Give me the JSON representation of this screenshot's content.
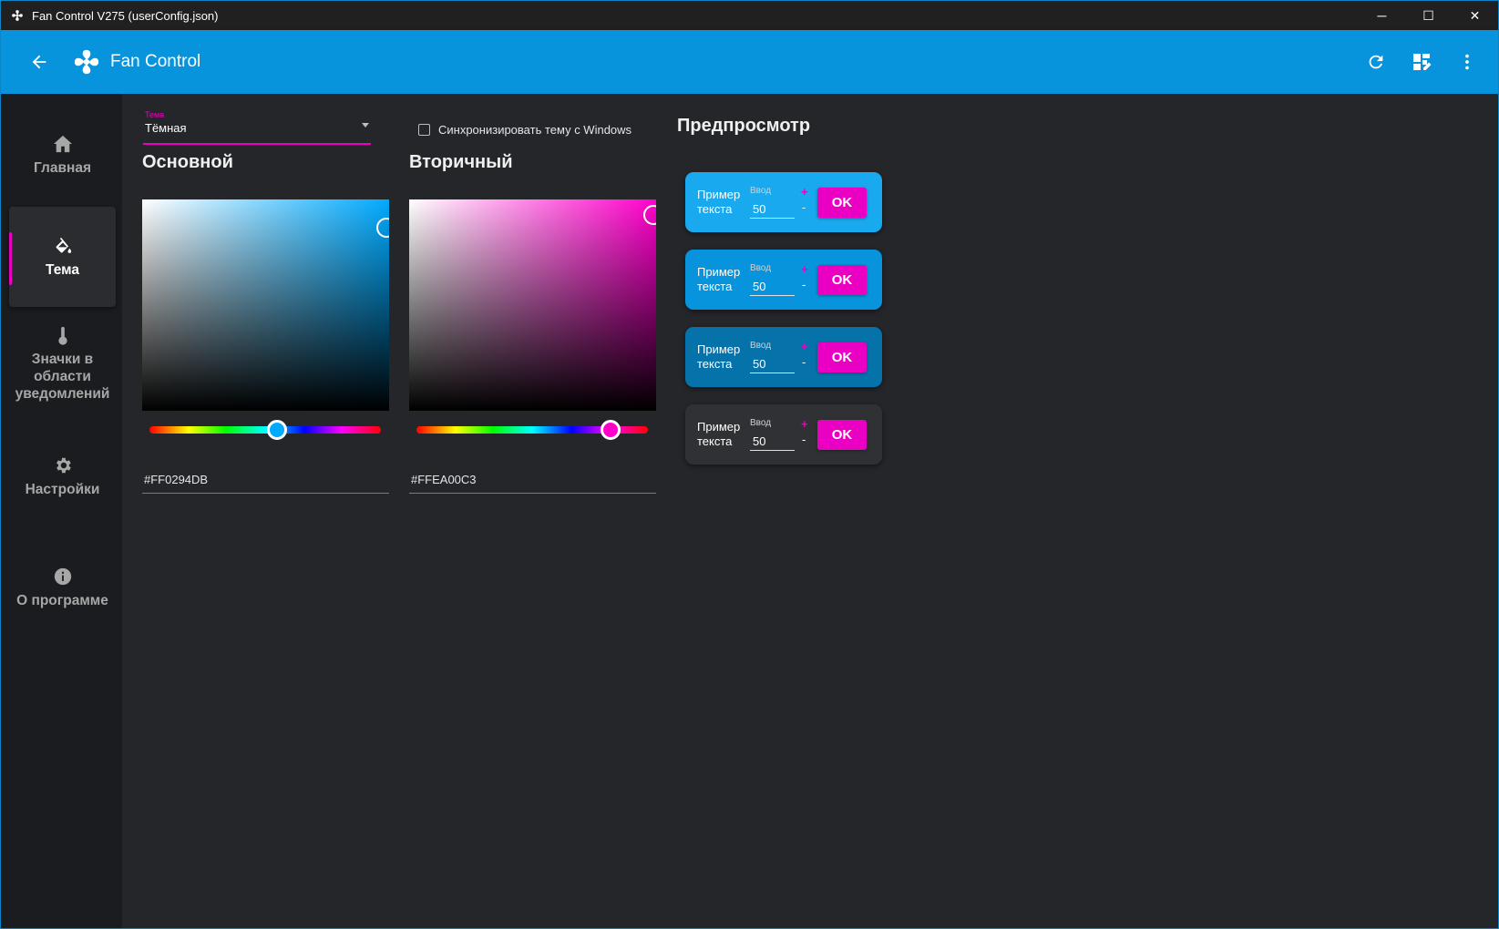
{
  "window": {
    "title": "Fan Control V275 (userConfig.json)",
    "minimize": "─",
    "maximize": "☐",
    "close": "✕"
  },
  "appbar": {
    "title": "Fan Control",
    "icons": [
      "back-arrow-icon",
      "fan-icon",
      "refresh-icon",
      "dashboard-edit-icon",
      "more-vert-icon"
    ]
  },
  "sidebar": {
    "items": [
      {
        "label": "Главная",
        "icon": "home-icon",
        "active": false
      },
      {
        "label": "Тема",
        "icon": "paint-bucket-icon",
        "active": true
      },
      {
        "label": "Значки в области уведомлений",
        "icon": "thermometer-icon",
        "active": false
      },
      {
        "label": "Настройки",
        "icon": "gear-icon",
        "active": false
      },
      {
        "label": "О программе",
        "icon": "info-icon",
        "active": false
      }
    ]
  },
  "theme": {
    "label": "Тема",
    "value": "Тёмная",
    "sync_label": "Синхронизировать тему с Windows",
    "sync_checked": false
  },
  "primary": {
    "title": "Основной",
    "hex": "#FF0294DB",
    "hue_color": "#00aaff",
    "slider_position": 0.55
  },
  "secondary": {
    "title": "Вторичный",
    "hex": "#FFEA00C3",
    "hue_color": "#ff00cc",
    "slider_position": 0.84
  },
  "preview": {
    "title": "Предпросмотр",
    "cards": [
      {
        "text": "Пример текста",
        "input_label": "Ввод",
        "input_value": "50",
        "plus": "+",
        "minus": "-",
        "button": "OK",
        "background": "#18a9ef"
      },
      {
        "text": "Пример текста",
        "input_label": "Ввод",
        "input_value": "50",
        "plus": "+",
        "minus": "-",
        "button": "OK",
        "background": "#0794dc"
      },
      {
        "text": "Пример текста",
        "input_label": "Ввод",
        "input_value": "50",
        "plus": "+",
        "minus": "-",
        "button": "OK",
        "background": "#0672aa"
      },
      {
        "text": "Пример текста",
        "input_label": "Ввод",
        "input_value": "50",
        "plus": "+",
        "minus": "-",
        "button": "OK",
        "background": "#303134"
      }
    ]
  },
  "colors": {
    "accent_primary": "#0294DB",
    "accent_secondary": "#EA00C3",
    "background": "#25262a",
    "sidebar": "#1b1c1f"
  }
}
